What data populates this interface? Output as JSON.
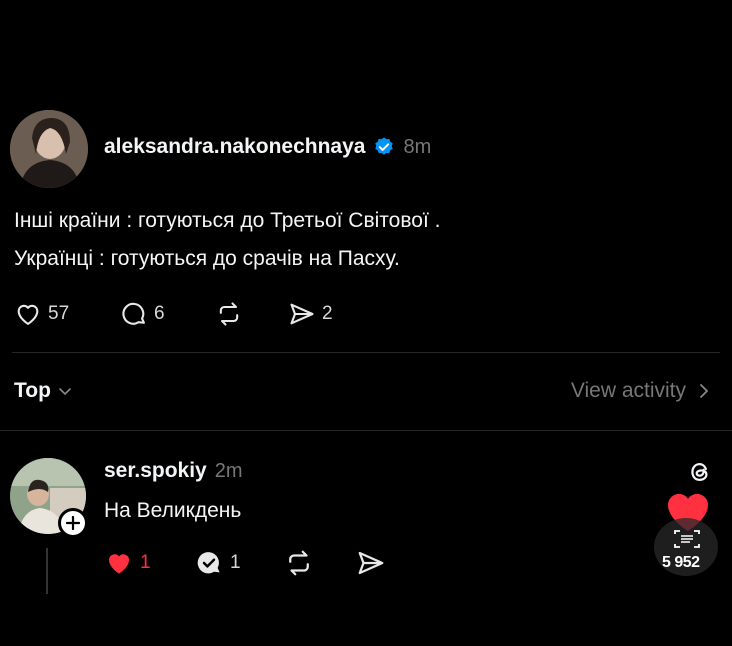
{
  "post": {
    "username": "aleksandra.nakonechnaya",
    "time": "8m",
    "lines": [
      "Інші країни : готуються до Третьої Світової .",
      "Українці : готуються до срачів на Пасху."
    ],
    "likes": "57",
    "comments": "6",
    "shares": "2"
  },
  "sort": {
    "label": "Top",
    "view_activity": "View activity"
  },
  "reply": {
    "username": "ser.spokiy",
    "time": "2m",
    "text": "На Великдень",
    "likes": "1",
    "comments": "1"
  },
  "overlay": {
    "count": "5 952"
  },
  "colors": {
    "background": "#000000",
    "verified": "#0095f6",
    "like_red": "#ff3040"
  }
}
